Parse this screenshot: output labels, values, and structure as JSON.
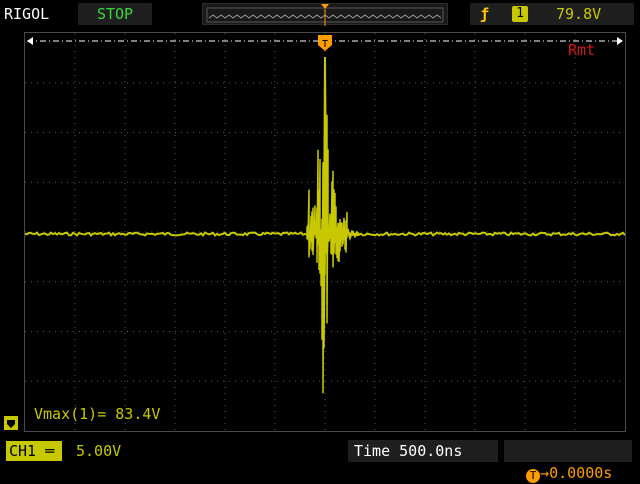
{
  "header": {
    "brand": "RIGOL",
    "status": "STOP",
    "trigger": {
      "edge_icon": "rising-edge-icon",
      "source": "1",
      "level": "79.8V"
    }
  },
  "screen": {
    "remote_label": "Rmt",
    "measurement": "Vmax(1)= 83.4V"
  },
  "footer": {
    "channel_label": "CH1",
    "channel_scale": "5.00V",
    "timebase": "Time 500.0ns",
    "trigger_delay": "0.0000s"
  },
  "colors": {
    "trace": "#c8c800",
    "status": "#37d837",
    "trigger": "#ff9c00",
    "remote": "#d01818"
  }
}
